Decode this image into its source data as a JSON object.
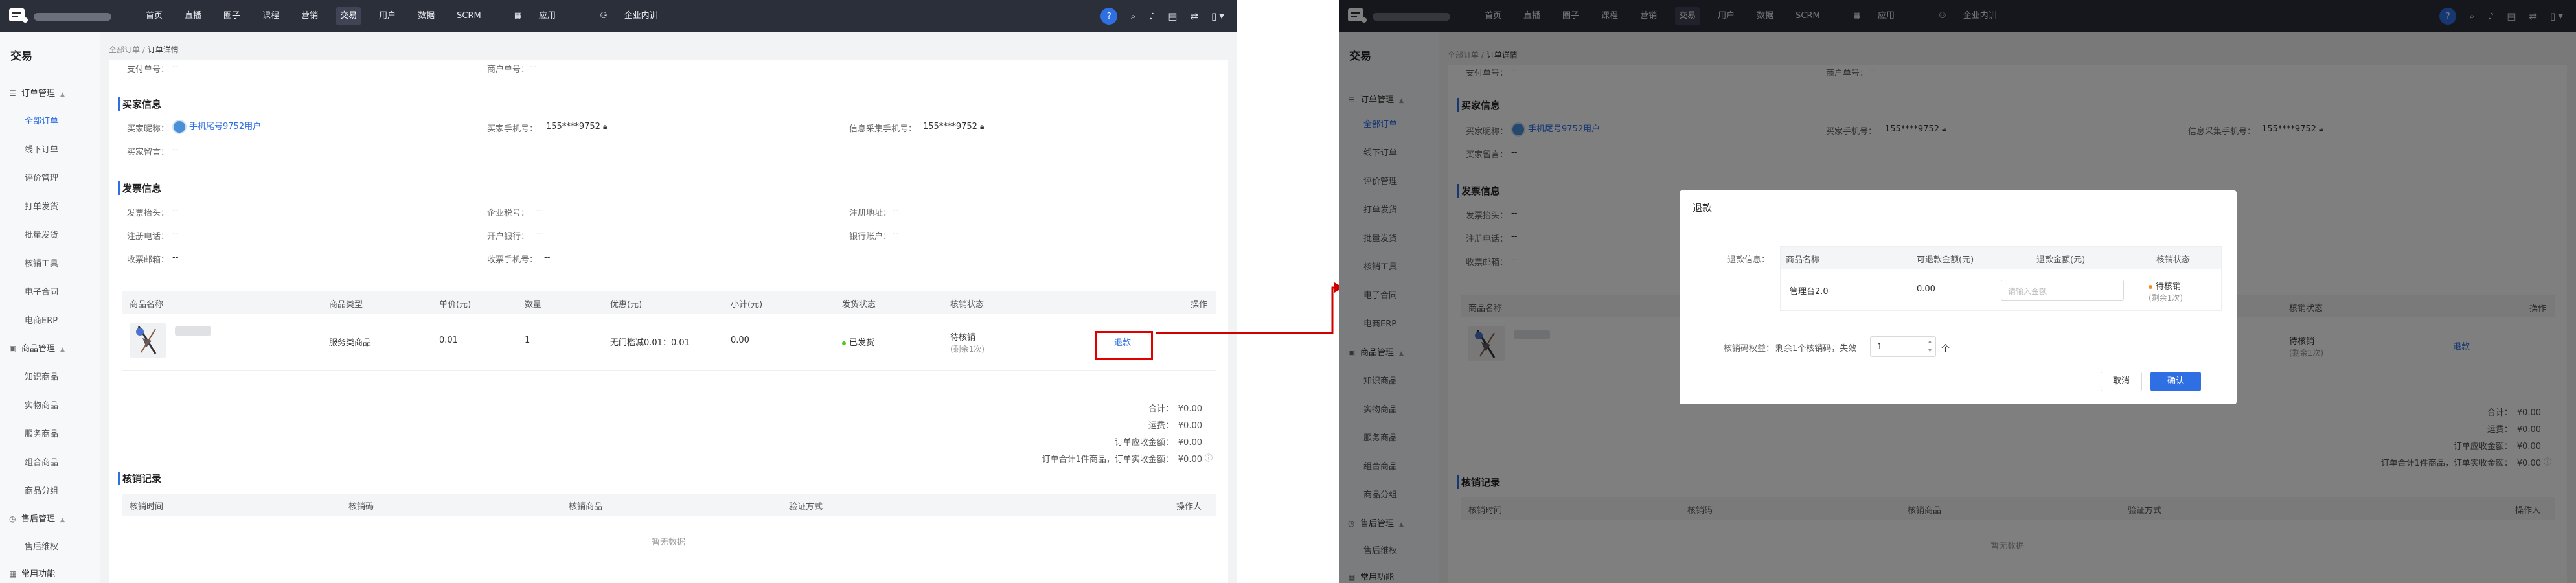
{
  "app": {
    "nav": [
      "首页",
      "直播",
      "圈子",
      "课程",
      "营销",
      "交易",
      "用户",
      "数据",
      "SCRM"
    ],
    "nav_active": "交易",
    "nav_app": "应用",
    "nav_corp": "企业内训",
    "icons": [
      "help-icon",
      "search-icon",
      "bell-icon",
      "calendar-icon",
      "transfer-icon",
      "device-icon",
      "chevron-down-icon"
    ]
  },
  "sidebar": {
    "title": "交易",
    "groups": [
      {
        "label": "订单管理",
        "icon": "order-icon",
        "items": [
          "全部订单",
          "线下订单",
          "评价管理",
          "打单发货",
          "批量发货",
          "核销工具",
          "电子合同",
          "电商ERP"
        ]
      },
      {
        "label": "商品管理",
        "icon": "goods-icon",
        "items": [
          "知识商品",
          "实物商品",
          "服务商品",
          "组合商品",
          "商品分组"
        ]
      },
      {
        "label": "售后管理",
        "icon": "aftersale-icon",
        "items": [
          "售后维权"
        ]
      },
      {
        "label": "常用功能",
        "icon": "grid-icon",
        "items": []
      }
    ],
    "active_item": "全部订单"
  },
  "breadcrumb": {
    "parent": "全部订单",
    "sep": "/",
    "current": "订单详情"
  },
  "order": {
    "pay_no_label": "支付单号：",
    "pay_no": "--",
    "merchant_no_label": "商户单号：",
    "merchant_no": "--"
  },
  "buyer": {
    "title": "买家信息",
    "nick_label": "买家昵称：",
    "nick": "手机尾号9752用户",
    "phone_label": "买家手机号：",
    "phone": "155****9752",
    "collect_label": "信息采集手机号：",
    "collect_phone": "155****9752",
    "remark_label": "买家留言：",
    "remark": "--"
  },
  "invoice": {
    "title": "发票信息",
    "rows": [
      [
        {
          "k": "发票抬头：",
          "v": "--"
        },
        {
          "k": "企业税号：",
          "v": "--"
        },
        {
          "k": "注册地址：",
          "v": "--"
        }
      ],
      [
        {
          "k": "注册电话：",
          "v": "--"
        },
        {
          "k": "开户银行：",
          "v": "--"
        },
        {
          "k": "银行账户：",
          "v": "--"
        }
      ],
      [
        {
          "k": "收票邮箱：",
          "v": "--"
        },
        {
          "k": "收票手机号：",
          "v": "--"
        }
      ]
    ]
  },
  "goods_table": {
    "headers": [
      "商品名称",
      "商品类型",
      "单价(元)",
      "数量",
      "优惠(元)",
      "小计(元)",
      "发货状态",
      "核销状态",
      "操作"
    ],
    "row": {
      "type": "服务类商品",
      "price": "0.01",
      "qty": "1",
      "discount": "无门槛减0.01：0.01",
      "subtotal": "0.00",
      "ship_status": "已发货",
      "verify_status": "待核销",
      "verify_sub": "(剩余1次)",
      "action": "退款"
    }
  },
  "summary": [
    {
      "k": "合计：",
      "v": "¥0.00"
    },
    {
      "k": "运费：",
      "v": "¥0.00"
    },
    {
      "k": "订单应收金额：",
      "v": "¥0.00"
    },
    {
      "k": "订单合计1件商品，订单实收金额：",
      "v": "¥0.00"
    }
  ],
  "verify_records": {
    "title": "核销记录",
    "headers": [
      "核销时间",
      "核销码",
      "核销商品",
      "验证方式",
      "操作人"
    ],
    "empty": "暂无数据"
  },
  "refund_dialog": {
    "title": "退款",
    "info_label": "退款信息：",
    "headers": [
      "商品名称",
      "可退款金额(元)",
      "退款金额(元)",
      "核销状态"
    ],
    "row": {
      "name": "管理台2.0",
      "refundable": "0.00",
      "amount_placeholder": "请输入金额",
      "status": "待核销",
      "status_sub": "(剩余1次)"
    },
    "code_label": "核销码权益：",
    "code_text": "剩余1个核销码，失效",
    "code_value": "1",
    "code_unit": "个",
    "cancel": "取消",
    "confirm": "确认"
  },
  "colors": {
    "accent": "#2f6fe4",
    "topbar": "#2b2f3a",
    "highlight": "#e00000",
    "success": "#52c41a"
  }
}
